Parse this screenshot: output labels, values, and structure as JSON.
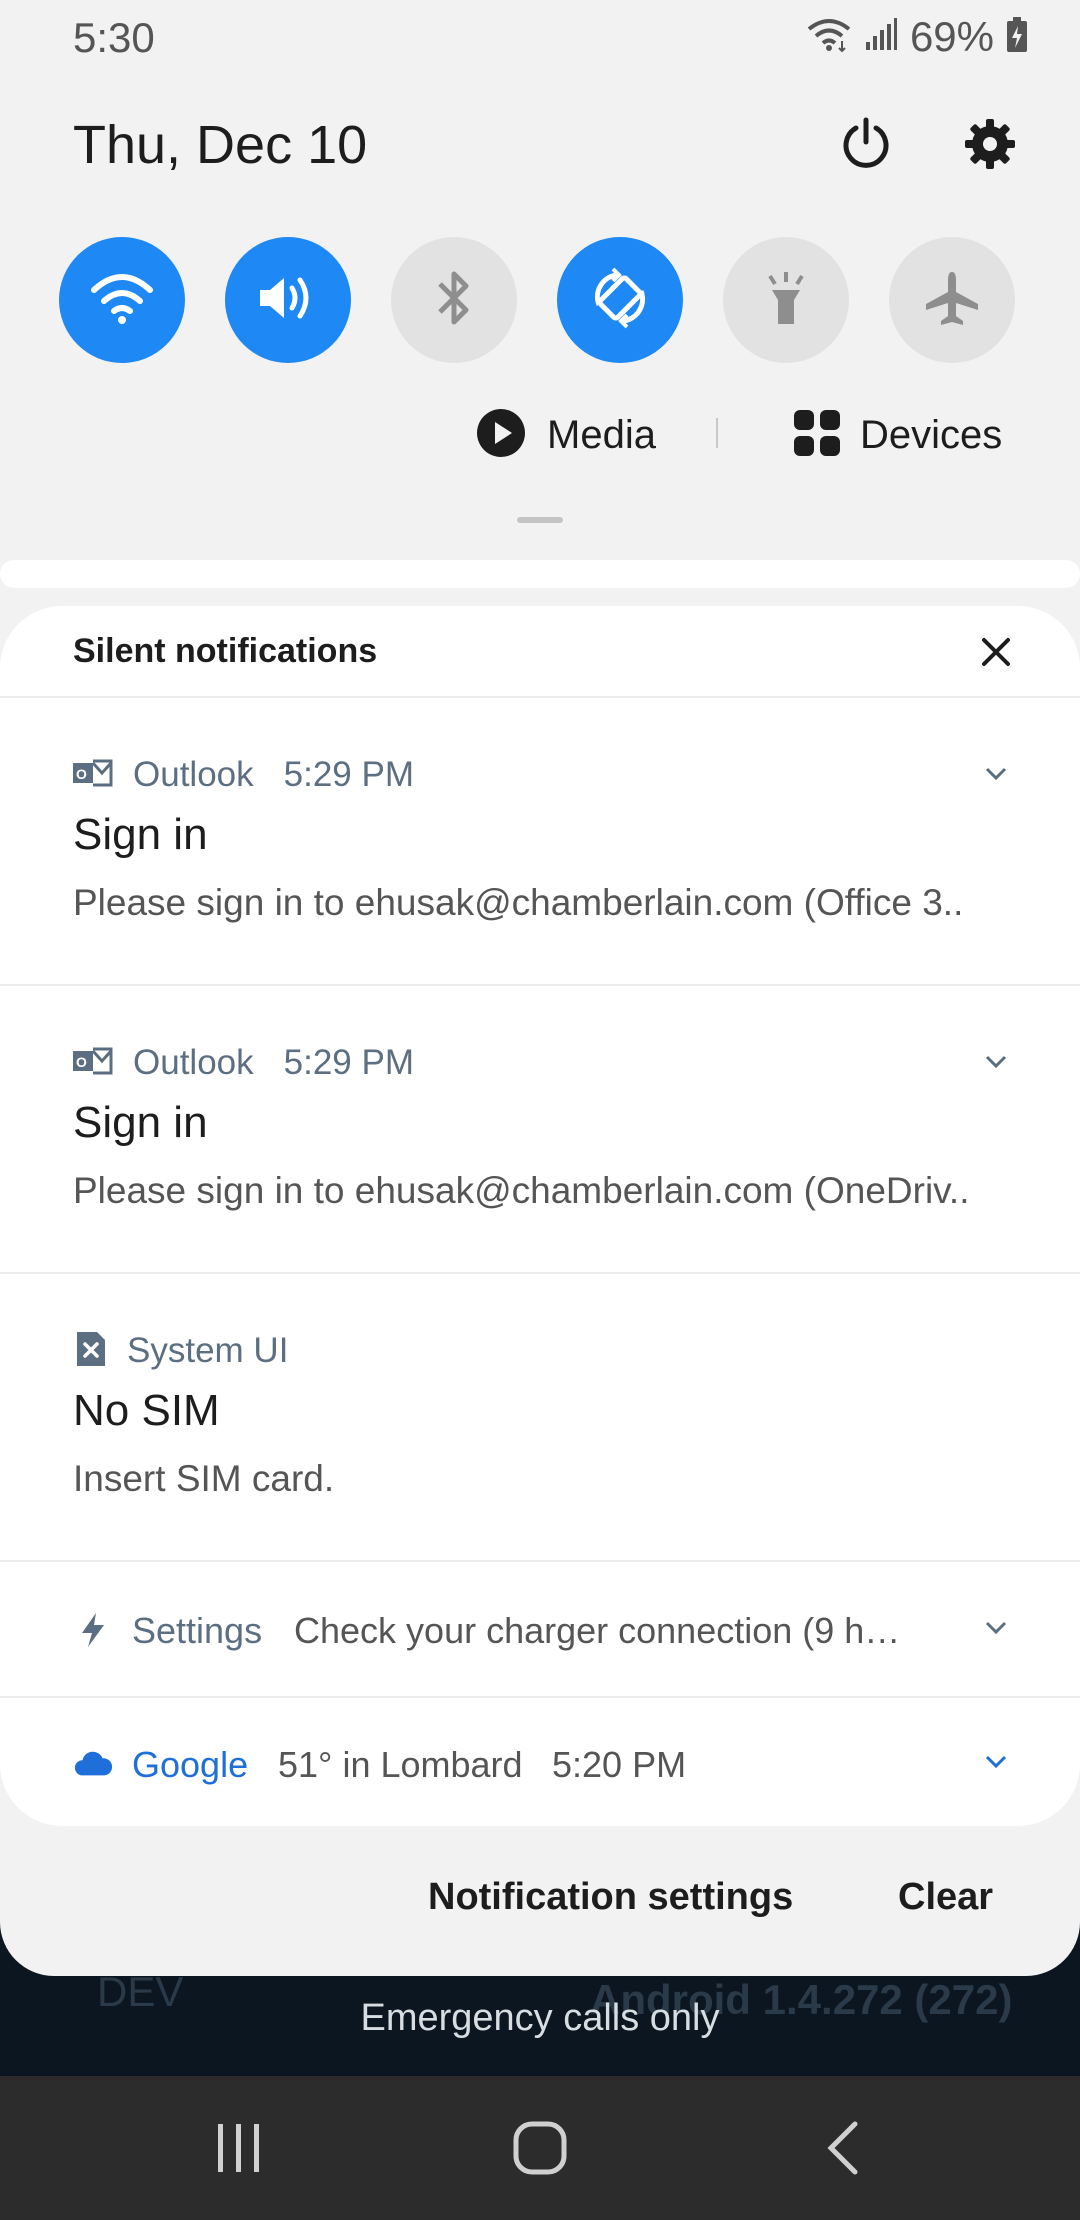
{
  "status_bar": {
    "time": "5:30",
    "battery_percent": "69%"
  },
  "header": {
    "date": "Thu, Dec 10",
    "power_icon": "power-icon",
    "settings_icon": "gear-icon"
  },
  "quick_toggles": [
    {
      "name": "wifi",
      "icon": "wifi-icon",
      "on": true
    },
    {
      "name": "sound",
      "icon": "volume-icon",
      "on": true
    },
    {
      "name": "bluetooth",
      "icon": "bluetooth-icon",
      "on": false
    },
    {
      "name": "auto-rotate",
      "icon": "rotate-icon",
      "on": true
    },
    {
      "name": "flashlight",
      "icon": "flashlight-icon",
      "on": false
    },
    {
      "name": "airplane-mode",
      "icon": "airplane-icon",
      "on": false
    }
  ],
  "media_row": {
    "media_label": "Media",
    "devices_label": "Devices"
  },
  "colors": {
    "accent": "#1e88f5",
    "toggle_off": "#e2e2e2",
    "google_blue": "#1e6fd9"
  },
  "notifications_card": {
    "title": "Silent notifications",
    "items": [
      {
        "app": "Outlook",
        "time": "5:29 PM",
        "title": "Sign in",
        "text": "Please sign in to ehusak@chamberlain.com (Office 3.."
      },
      {
        "app": "Outlook",
        "time": "5:29 PM",
        "title": "Sign in",
        "text": "Please sign in to ehusak@chamberlain.com (OneDriv.."
      },
      {
        "app": "System UI",
        "title": "No SIM",
        "text": "Insert SIM card."
      }
    ],
    "settings_row": {
      "app": "Settings",
      "text": "Check your charger connection (9 h…"
    },
    "google_row": {
      "app": "Google",
      "weather": "51° in Lombard",
      "time": "5:20 PM"
    }
  },
  "footer": {
    "notification_settings": "Notification settings",
    "clear": "Clear"
  },
  "lockscreen_behind": {
    "dev_label": "DEV",
    "version": "Android 1.4.272 (272)",
    "emergency": "Emergency calls only"
  }
}
